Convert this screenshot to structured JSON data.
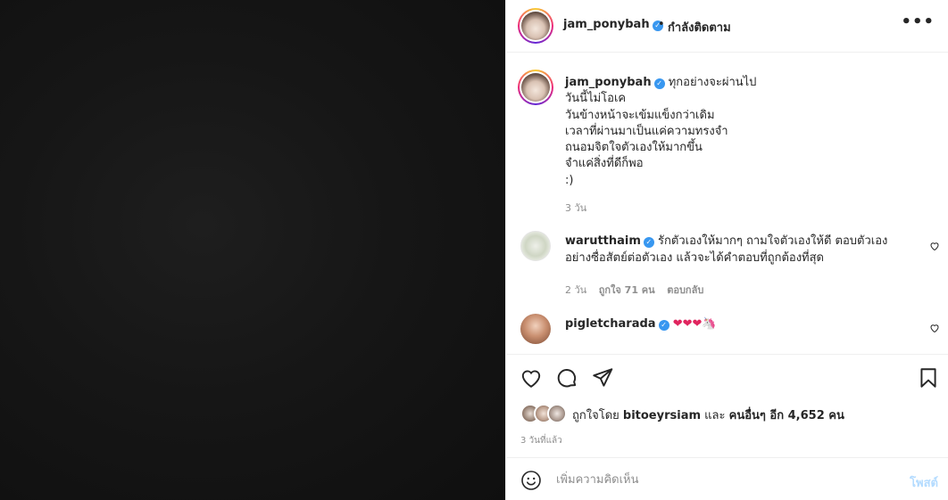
{
  "header": {
    "username": "jam_ponybah",
    "dot": "•",
    "follow_status": "กำลังติดตาม",
    "more": "•••"
  },
  "caption": {
    "username": "jam_ponybah",
    "lines": [
      "ทุกอย่างจะผ่านไป",
      "วันนี้ไม่โอเค",
      "วันข้างหน้าจะเข้มแข็งกว่าเดิม",
      "เวลาที่ผ่านมาเป็นแค่ความทรงจำ",
      "ถนอมจิตใจตัวเองให้มากขึ้น",
      "จำแค่สิ่งที่ดีก็พอ",
      ":)"
    ],
    "time": "3 วัน"
  },
  "comments": [
    {
      "username": "warutthaim",
      "text": "รักตัวเองให้มากๆ ถามใจตัวเองให้ดี ตอบตัวเองอย่างซื่อสัตย์ต่อตัวเอง แล้วจะได้คำตอบที่ถูกต้องที่สุด",
      "time": "2 วัน",
      "likes": "ถูกใจ 71 คน",
      "reply": "ตอบกลับ"
    },
    {
      "username": "pigletcharada",
      "text": "❤❤❤🦄"
    }
  ],
  "actions": {
    "likes_prefix": "ถูกใจโดย",
    "liked_by": "bitoeyrsiam",
    "and": "และ",
    "others": "คนอื่นๆ อีก 4,652 คน",
    "time_ago": "3 วันที่แล้ว"
  },
  "add_comment": {
    "placeholder": "เพิ่มความคิดเห็น",
    "post_label": "โพสต์"
  },
  "colors": {
    "verified": "#3897f0",
    "post_button_disabled": "#b3dbff",
    "meta_gray": "#8e8e8e"
  }
}
